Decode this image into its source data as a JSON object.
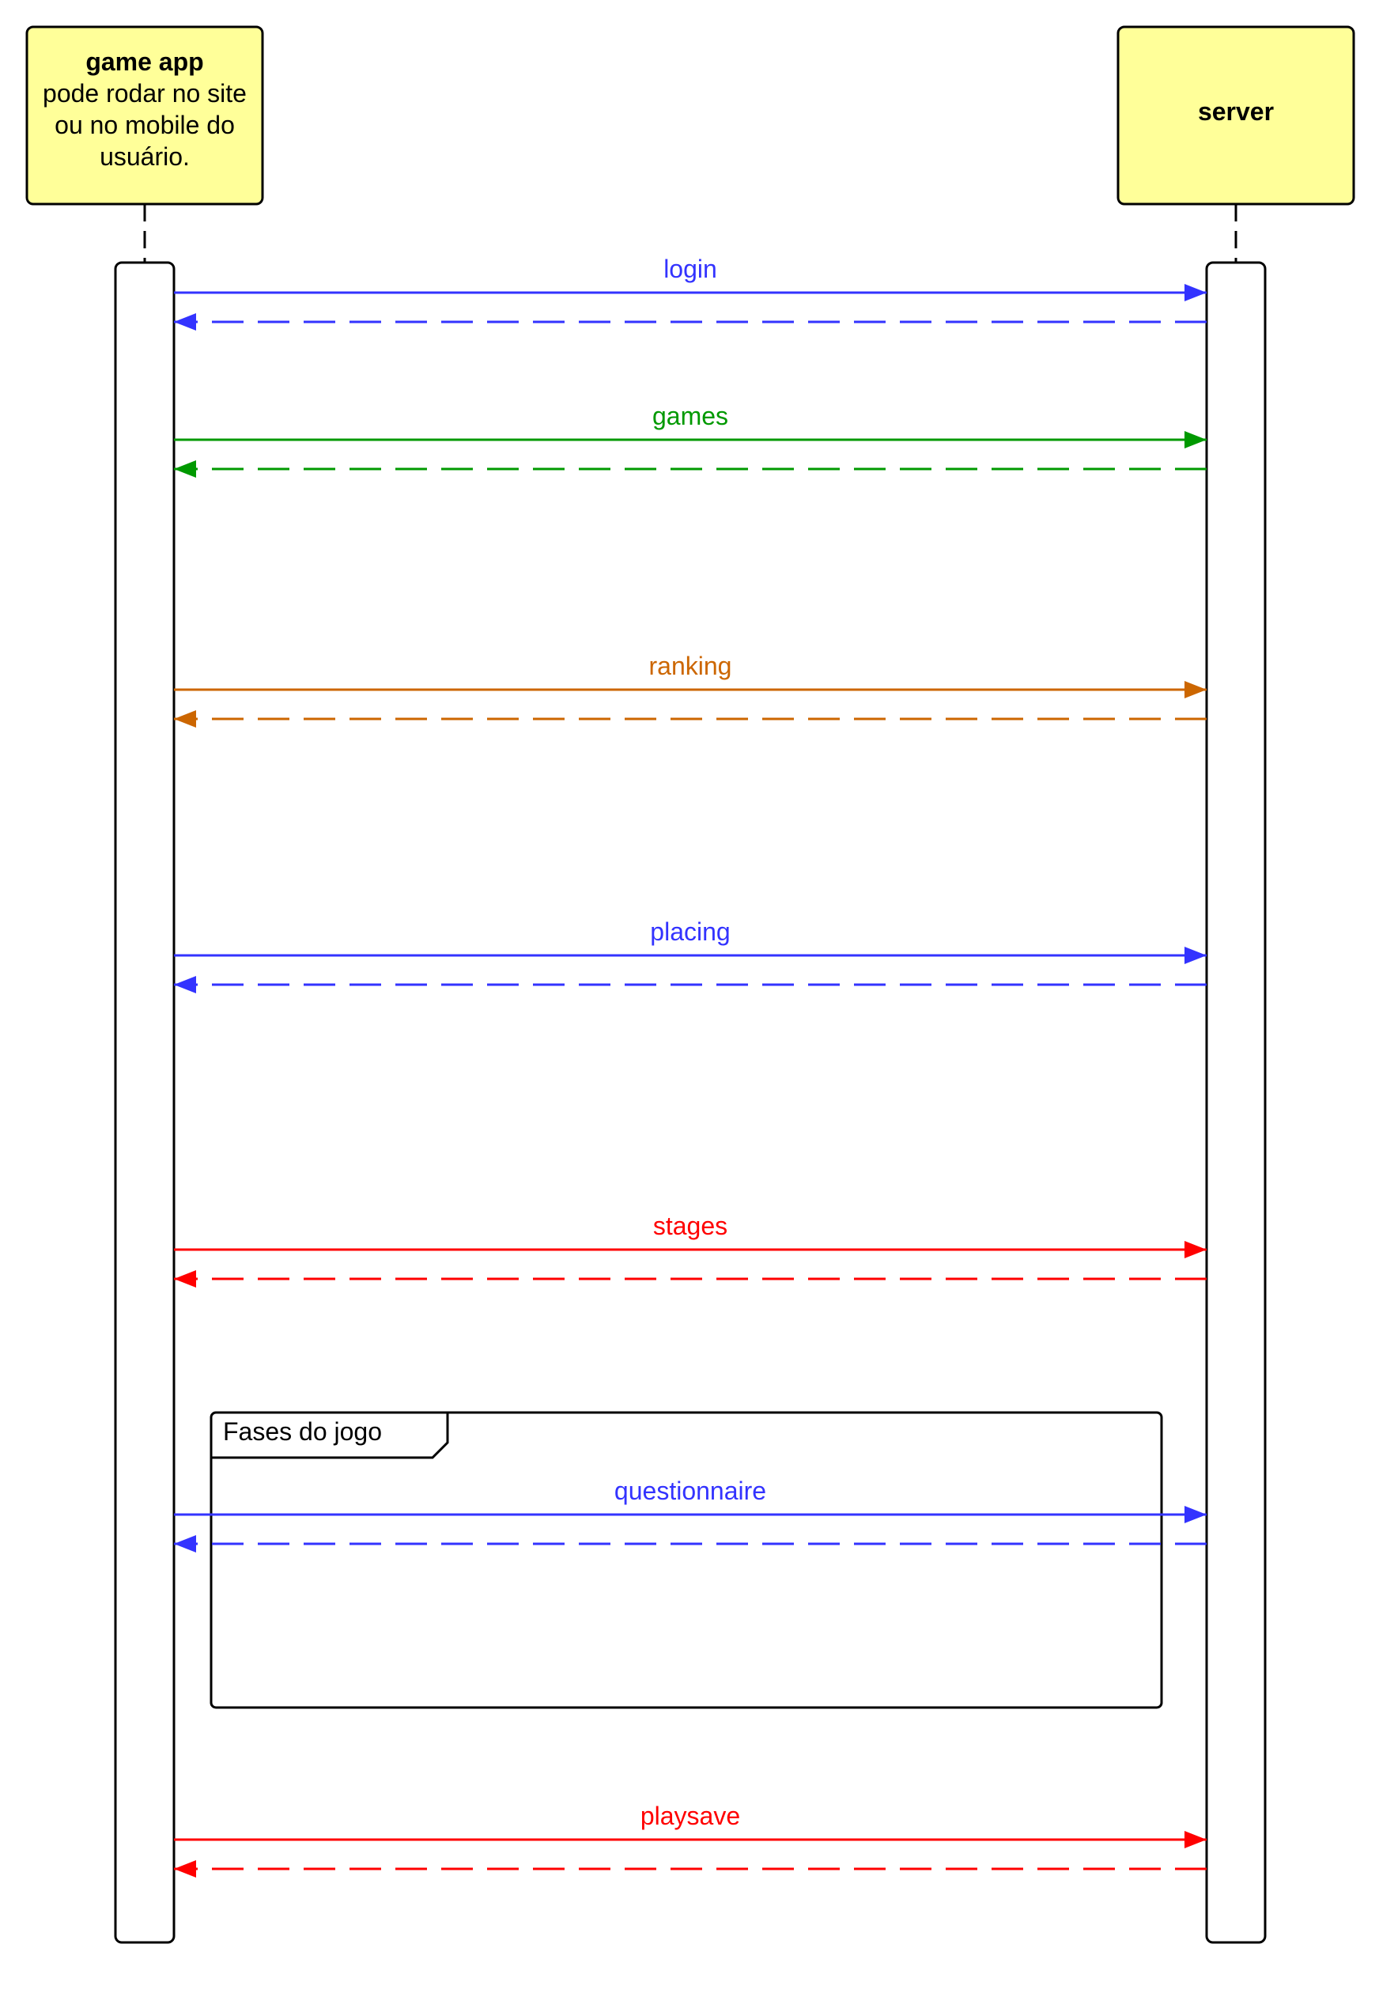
{
  "participants": {
    "app": {
      "title": "game app",
      "desc_lines": [
        "pode rodar no site",
        "ou no mobile do",
        "usuário."
      ]
    },
    "server": {
      "title": "server"
    }
  },
  "fragment": {
    "label": "Fases do jogo"
  },
  "messages": [
    {
      "label": "login",
      "color": "#3333ff"
    },
    {
      "label": "games",
      "color": "#009900"
    },
    {
      "label": "ranking",
      "color": "#cc6600"
    },
    {
      "label": "placing",
      "color": "#3333ff"
    },
    {
      "label": "stages",
      "color": "#ff0000"
    },
    {
      "label": "questionnaire",
      "color": "#3333ff"
    },
    {
      "label": "playsave",
      "color": "#ff0000"
    }
  ],
  "colors": {
    "participant_fill": "#ffff99",
    "line": "#000000"
  }
}
